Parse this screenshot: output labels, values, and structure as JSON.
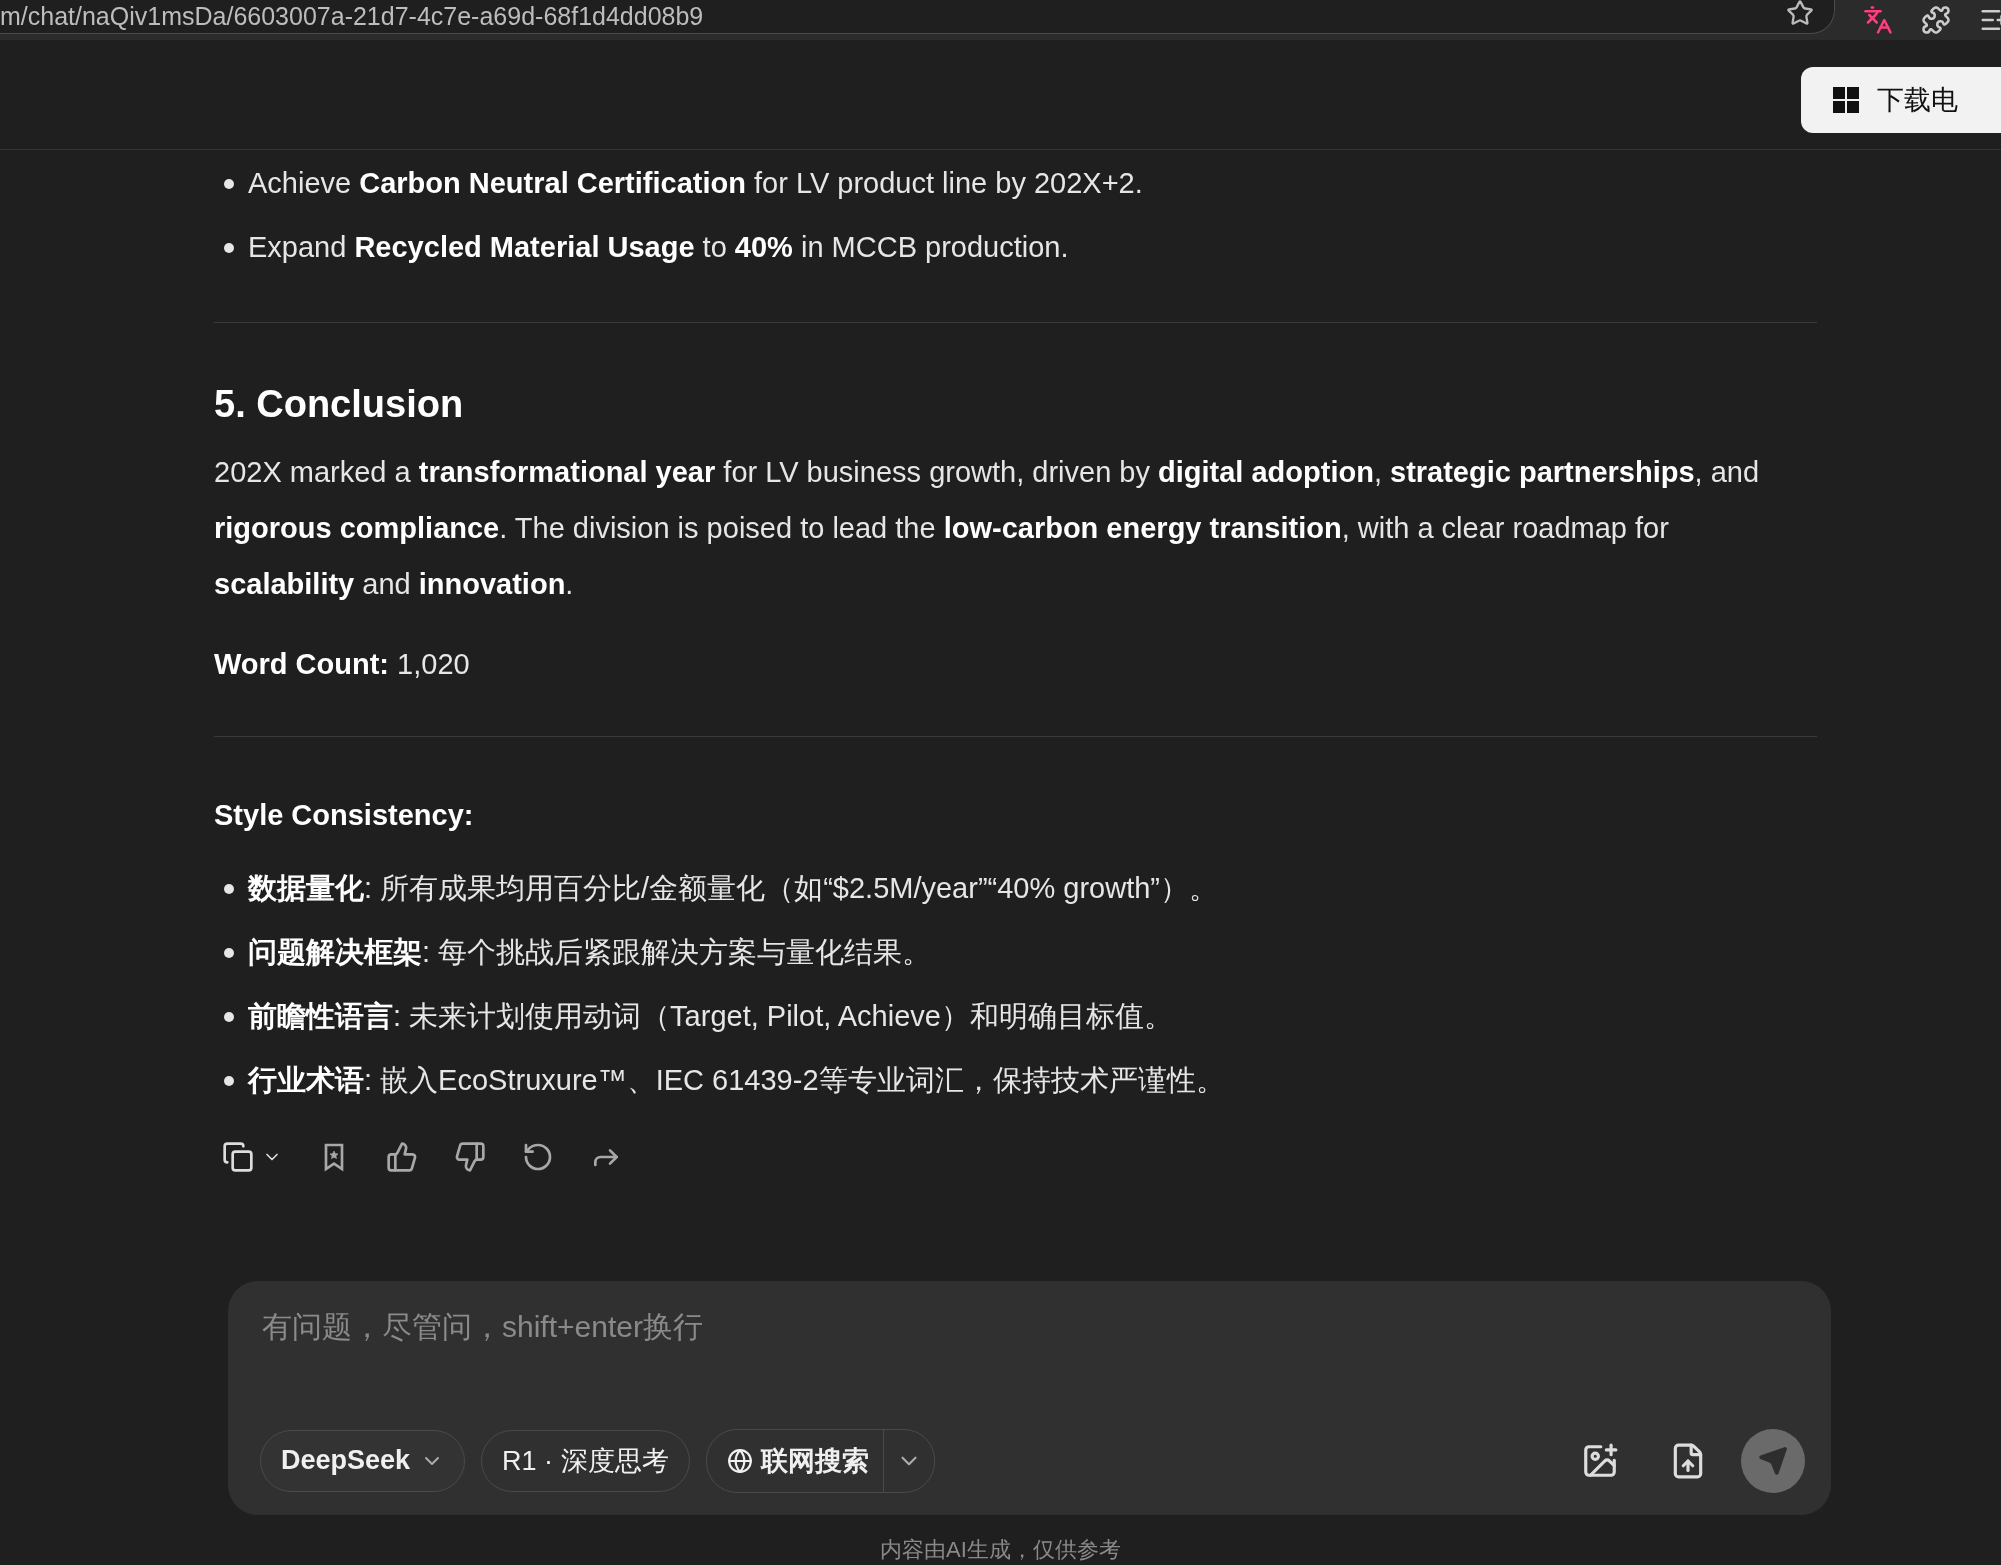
{
  "browser": {
    "url": "m/chat/naQiv1msDa/6603007a-21d7-4c7e-a69d-68f1d4dd08b9",
    "download_button": "下载电"
  },
  "message": {
    "bullets_top": [
      "Achieve **Carbon Neutral Certification** for LV product line by 202X+2.",
      "Expand **Recycled Material Usage** to **40%** in MCCB production."
    ],
    "heading": "5. Conclusion",
    "paragraph": "202X marked a **transformational year** for LV business growth, driven by **digital adoption**, **strategic partnerships**, and **rigorous compliance**. The division is poised to lead the **low-carbon energy transition**, with a clear roadmap for **scalability** and **innovation**.",
    "word_count": "**Word Count:** 1,020",
    "style_heading": "Style Consistency:",
    "style_bullets": [
      "**数据量化**: 所有成果均用百分比/金额量化（如“$2.5M/year”“40% growth”）。",
      "**问题解决框架**: 每个挑战后紧跟解决方案与量化结果。",
      "**前瞻性语言**: 未来计划使用动词（Target, Pilot, Achieve）和明确目标值。",
      "**行业术语**: 嵌入EcoStruxure™、IEC 61439-2等专业词汇，保持技术严谨性。"
    ]
  },
  "input": {
    "placeholder": "有问题，尽管问，shift+enter换行",
    "model_button": "DeepSeek",
    "think_button": "R1 · 深度思考",
    "search_button": "联网搜索"
  },
  "footer_note": "内容由AI生成，仅供参考"
}
